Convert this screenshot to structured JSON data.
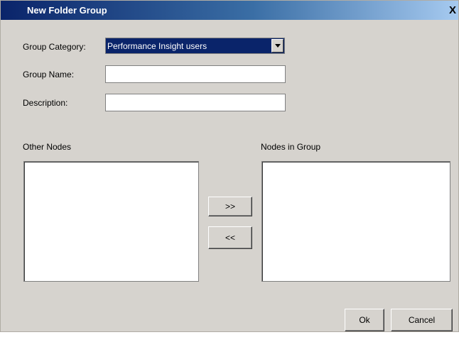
{
  "window": {
    "title": "New Folder Group",
    "close_label": "X"
  },
  "form": {
    "category_label": "Group Category:",
    "category_value": "Performance Insight users",
    "name_label": "Group Name:",
    "name_value": "",
    "description_label": "Description:",
    "description_value": ""
  },
  "lists": {
    "other_label": "Other Nodes",
    "group_label": "Nodes in Group",
    "add_label": ">>",
    "remove_label": "<<"
  },
  "footer": {
    "ok_label": "Ok",
    "cancel_label": "Cancel"
  },
  "colors": {
    "titlebar_start": "#0a246a",
    "dialog_bg": "#d6d3ce",
    "selection_bg": "#0a246a"
  }
}
